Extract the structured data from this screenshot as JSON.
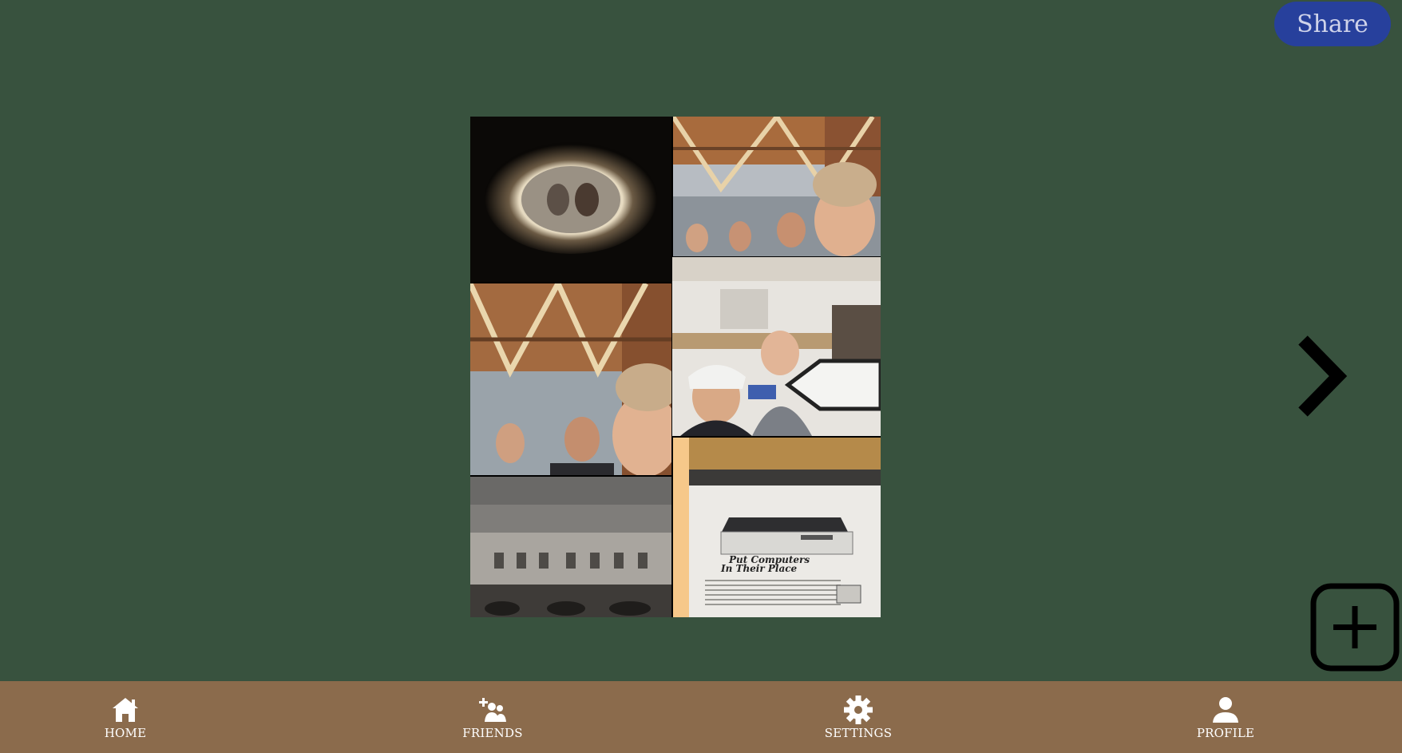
{
  "header": {
    "share_label": "Share"
  },
  "collage": {
    "photos": [
      {
        "name": "peephole-photo"
      },
      {
        "name": "hallway-selfie-photo"
      },
      {
        "name": "hallway-selfie-closeup-photo"
      },
      {
        "name": "buffalo-selfie-photo"
      },
      {
        "name": "historic-building-photo"
      },
      {
        "name": "computer-ad-photo",
        "caption_line1": "Put Computers",
        "caption_line2": "In Their Place"
      }
    ]
  },
  "nav": {
    "items": [
      {
        "label": "HOME",
        "icon": "home-icon"
      },
      {
        "label": "FRIENDS",
        "icon": "friends-icon"
      },
      {
        "label": "SETTINGS",
        "icon": "gear-icon"
      },
      {
        "label": "PROFILE",
        "icon": "profile-icon"
      }
    ]
  },
  "colors": {
    "background": "#38523e",
    "share_button": "#27409c",
    "nav_bar": "#8b6b4c"
  }
}
